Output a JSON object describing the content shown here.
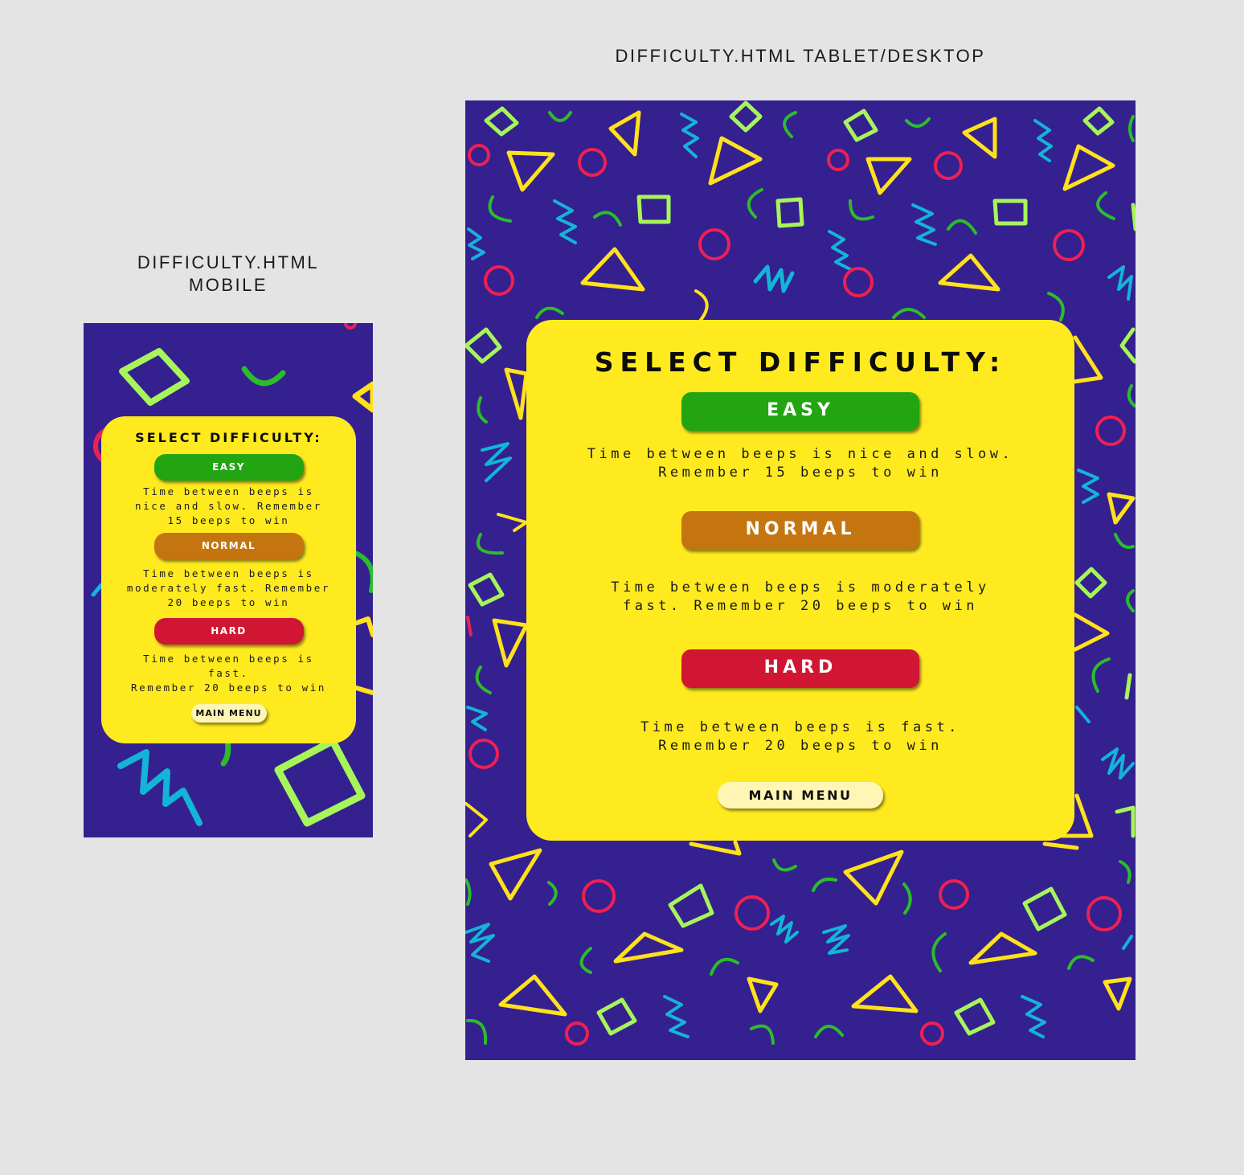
{
  "mobile": {
    "label": "DIFFICULTY.HTML",
    "label_line2": "MOBILE",
    "title": "SELECT DIFFICULTY:",
    "buttons": {
      "easy": "EASY",
      "normal": "NORMAL",
      "hard": "HARD",
      "menu": "MAIN MENU"
    },
    "descriptions": {
      "easy": [
        "Time between beeps is",
        "nice and slow. Remember",
        "15 beeps to win"
      ],
      "normal": [
        "Time between beeps is",
        "moderately fast. Remember",
        "20 beeps to win"
      ],
      "hard": [
        "Time between beeps is",
        "fast.",
        "Remember 20 beeps to win"
      ]
    }
  },
  "desktop": {
    "label": "DIFFICULTY.HTML TABLET/DESKTOP",
    "title": "SELECT DIFFICULTY:",
    "buttons": {
      "easy": "EASY",
      "normal": "NORMAL",
      "hard": "HARD",
      "menu": "MAIN MENU"
    },
    "descriptions": {
      "easy": [
        "Time between beeps is nice and slow.",
        "Remember 15 beeps to win"
      ],
      "normal": [
        "Time between beeps is moderately",
        "fast. Remember 20 beeps to win"
      ],
      "hard": [
        "Time between beeps is fast.",
        "Remember 20 beeps to win"
      ]
    }
  },
  "colors": {
    "background": "#35208f",
    "card": "#ffea20",
    "easy": "#22a511",
    "normal": "#c57510",
    "hard": "#d01632",
    "menu": "#fff6b5",
    "shape_lime": "#a6f55a",
    "shape_green": "#2bbd2b",
    "shape_yellow": "#ffe11c",
    "shape_red": "#ee2052",
    "shape_cyan": "#13b4d8"
  }
}
